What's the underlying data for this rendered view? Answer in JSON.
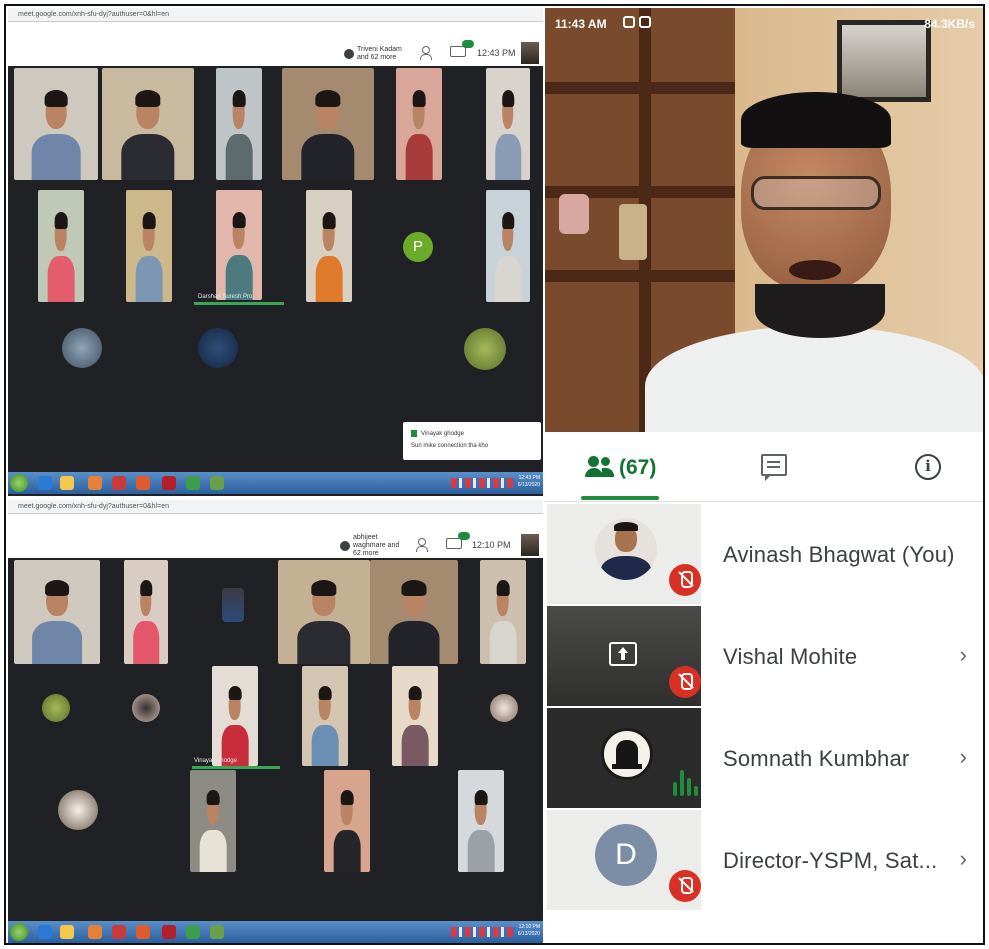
{
  "desktop_top": {
    "url": "meet.google.com/xnh-sfu-dyj?authuser=0&hl=en",
    "pinned_name": "Triveni Kadam and 62 more",
    "time": "12:43 PM",
    "speaking_name": "Darshan Suresh Pro",
    "participant_initial": "P",
    "notice_line1": "Vinayak ghodge",
    "notice_line2": "Sun mike connection tha kho",
    "taskbar_time": "12:43 PM",
    "taskbar_date": "6/13/2020"
  },
  "desktop_bottom": {
    "url": "meet.google.com/xnh-sfu-dyj?authuser=0&hl=en",
    "pinned_name": "abhijeet waghmare and 62 more",
    "time": "12:10 PM",
    "speaking_name": "Vinayak ghodge",
    "taskbar_time": "12:10 PM",
    "taskbar_date": "6/13/2020"
  },
  "phone": {
    "status_time": "11:43 AM",
    "status_network": "84.3KB/s",
    "tabs": {
      "people_count": "(67)",
      "people_icon": "people-icon",
      "chat_icon": "chat-icon",
      "info_icon": "info-icon"
    },
    "participants": [
      {
        "name": "Avinash Bhagwat (You)",
        "status": "muted"
      },
      {
        "name": "Vishal Mohite",
        "status": "muted",
        "chevron": "›"
      },
      {
        "name": "Somnath Kumbhar",
        "status": "speaking",
        "chevron": "›"
      },
      {
        "name": "Director-YSPM, Sat...",
        "avatar_letter": "D",
        "status": "muted",
        "chevron": "›"
      }
    ]
  },
  "colors": {
    "meet_bg": "#202124",
    "accent_green": "#1e8e3e",
    "mute_red": "#d93025",
    "taskbar_blue": "#2b5f9e"
  }
}
